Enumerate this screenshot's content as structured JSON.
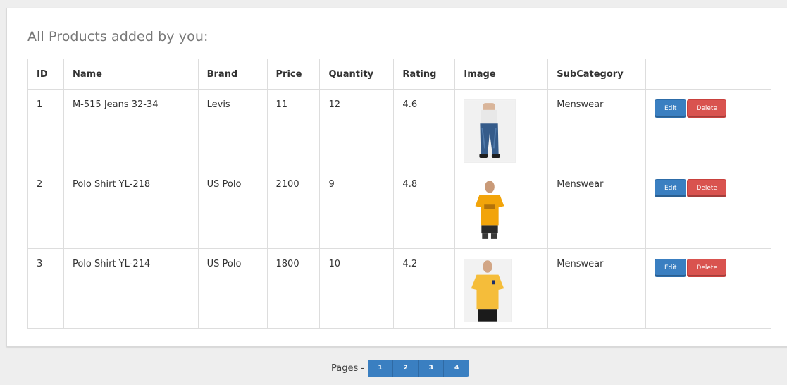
{
  "panel": {
    "title": "All Products added by you:"
  },
  "table": {
    "headers": [
      "ID",
      "Name",
      "Brand",
      "Price",
      "Quantity",
      "Rating",
      "Image",
      "SubCategory",
      ""
    ],
    "rows": [
      {
        "id": "1",
        "name": "M-515 Jeans 32-34",
        "brand": "Levis",
        "price": "11",
        "quantity": "12",
        "rating": "4.6",
        "image": "jeans",
        "subcategory": "Menswear",
        "edit": "Edit",
        "delete": "Delete"
      },
      {
        "id": "2",
        "name": "Polo Shirt YL-218",
        "brand": "US Polo",
        "price": "2100",
        "quantity": "9",
        "rating": "4.8",
        "image": "polo-orange",
        "subcategory": "Menswear",
        "edit": "Edit",
        "delete": "Delete"
      },
      {
        "id": "3",
        "name": "Polo Shirt YL-214",
        "brand": "US Polo",
        "price": "1800",
        "quantity": "10",
        "rating": "4.2",
        "image": "polo-yellow",
        "subcategory": "Menswear",
        "edit": "Edit",
        "delete": "Delete"
      }
    ]
  },
  "pager": {
    "label": "Pages -",
    "pages": [
      "1",
      "2",
      "3",
      "4"
    ]
  },
  "colors": {
    "primary": "#3a7fc1",
    "danger": "#d9534f",
    "background": "#eeeeee"
  }
}
